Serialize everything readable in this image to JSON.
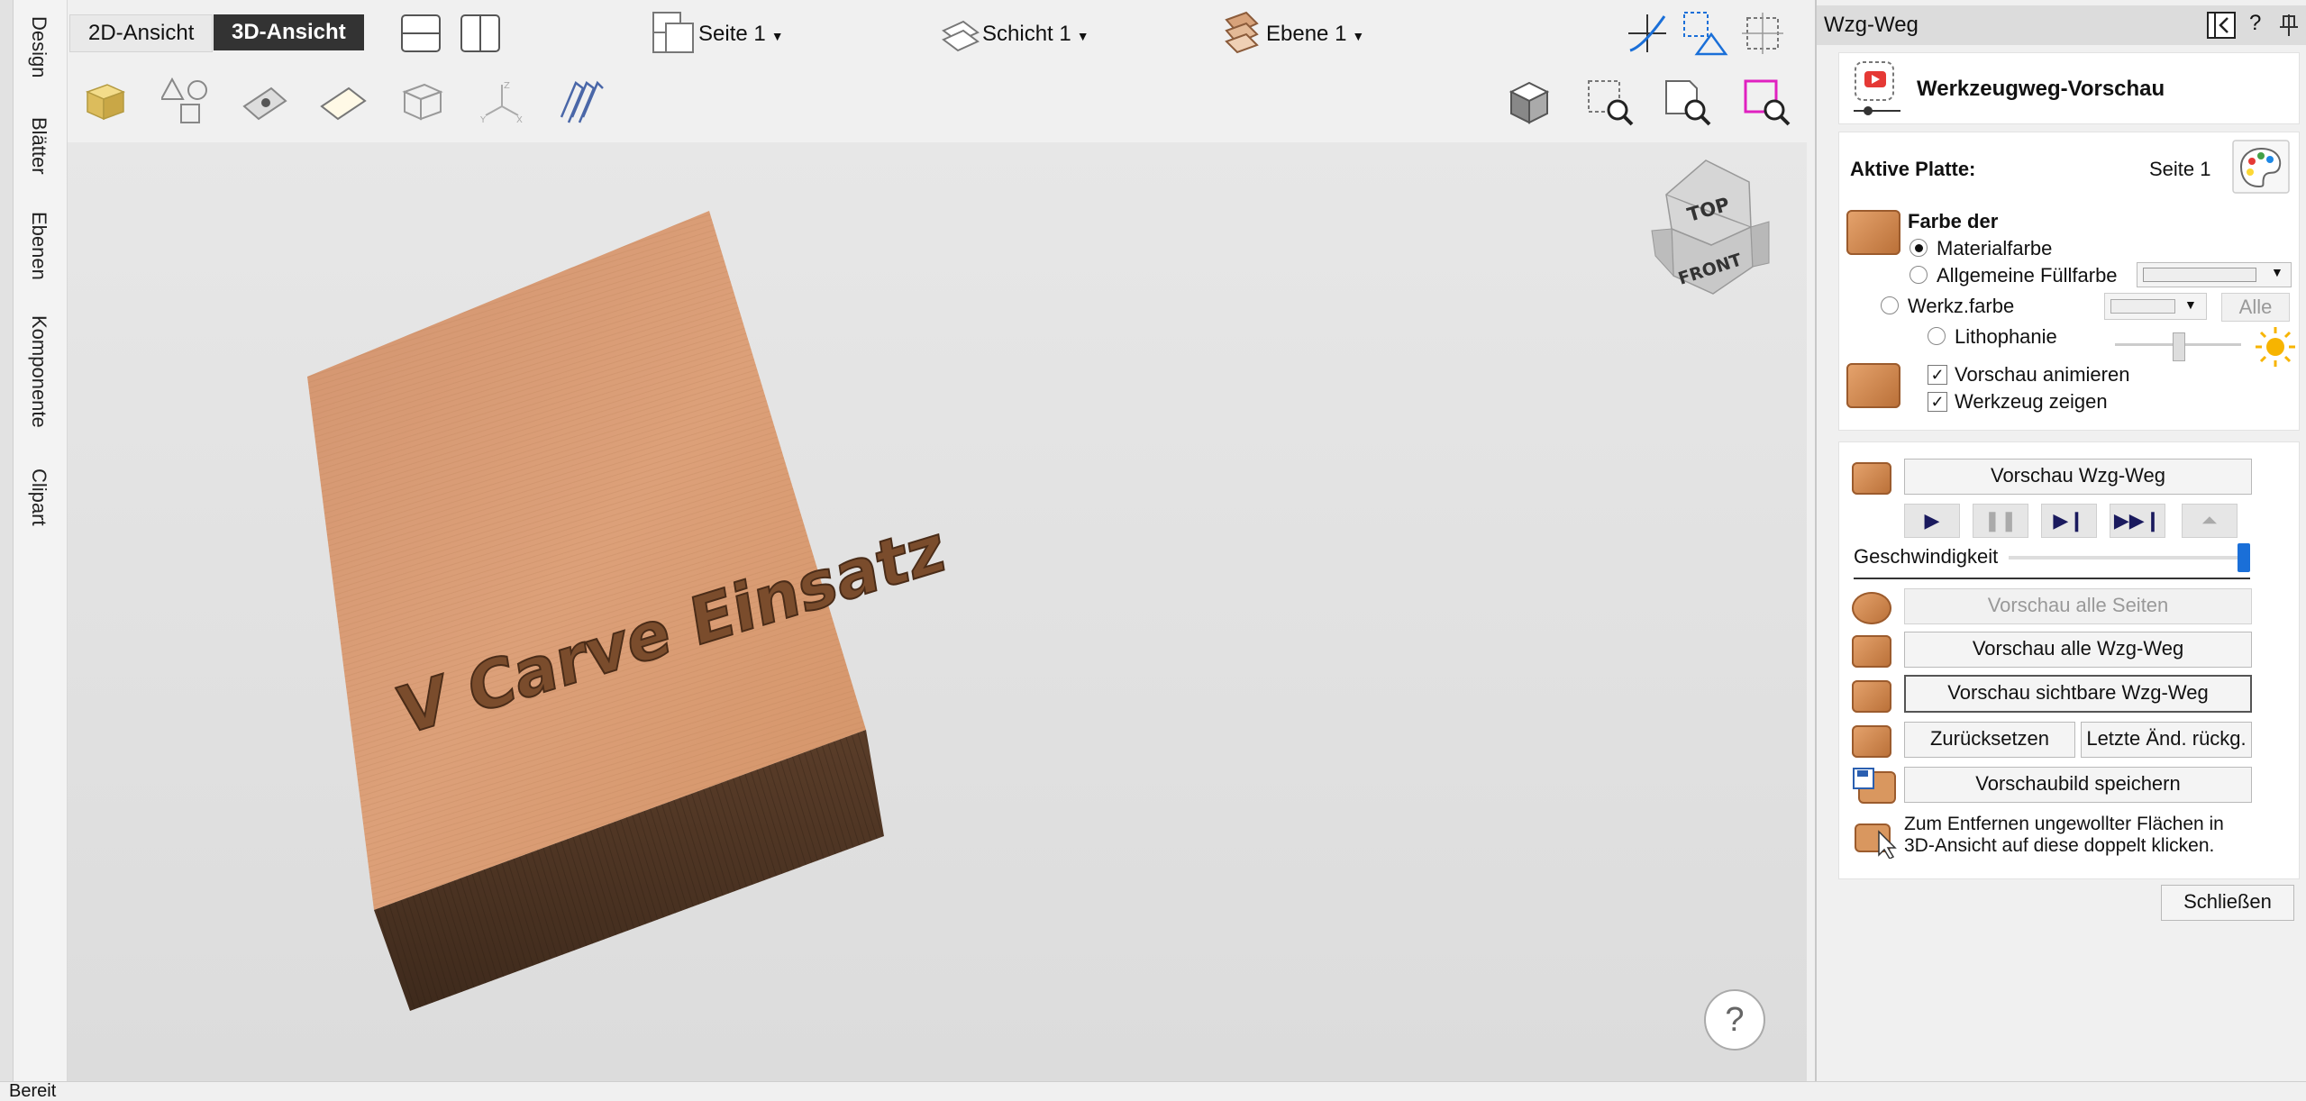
{
  "left_tabs": [
    "Design",
    "Blätter",
    "Ebenen",
    "Komponente",
    "Clipart"
  ],
  "top": {
    "view_2d": "2D-Ansicht",
    "view_3d": "3D-Ansicht",
    "sheet": "Seite 1",
    "layer": "Schicht 1",
    "level": "Ebene 1"
  },
  "viewport": {
    "carved_text": "V Carve Einsatz",
    "cube_top": "TOP",
    "cube_front": "FRONT",
    "help_glyph": "?"
  },
  "panel": {
    "title": "Wzg-Weg",
    "help": "?",
    "heading": "Werkzeugweg-Vorschau",
    "active_plate_label": "Aktive Platte:",
    "active_plate_value": "Seite 1",
    "color_of": "Farbe der",
    "radio_material": "Materialfarbe",
    "radio_fill": "Allgemeine Füllfarbe",
    "radio_tool": "Werkz.farbe",
    "btn_all": "Alle",
    "radio_litho": "Lithophanie",
    "chk_animate": "Vorschau animieren",
    "chk_show_tool": "Werkzeug zeigen",
    "btn_preview_toolpath": "Vorschau Wzg-Weg",
    "speed_label": "Geschwindigkeit",
    "speed_value": 1.0,
    "btn_preview_all_sheets": "Vorschau alle Seiten",
    "btn_preview_all_toolpaths": "Vorschau alle Wzg-Weg",
    "btn_preview_visible_toolpaths": "Vorschau sichtbare Wzg-Weg",
    "btn_reset": "Zurücksetzen",
    "btn_undo_last": "Letzte Änd. rückg.",
    "btn_save_preview": "Vorschaubild speichern",
    "hint_line1": "Zum Entfernen ungewollter Flächen in",
    "hint_line2": "3D-Ansicht auf diese doppelt klicken.",
    "btn_close": "Schließen"
  },
  "status": "Bereit",
  "colors": {
    "accent": "#1a6fd8",
    "wood_top": "#d99a6c",
    "wood_side": "#4e3524",
    "dark_button": "#333333"
  }
}
